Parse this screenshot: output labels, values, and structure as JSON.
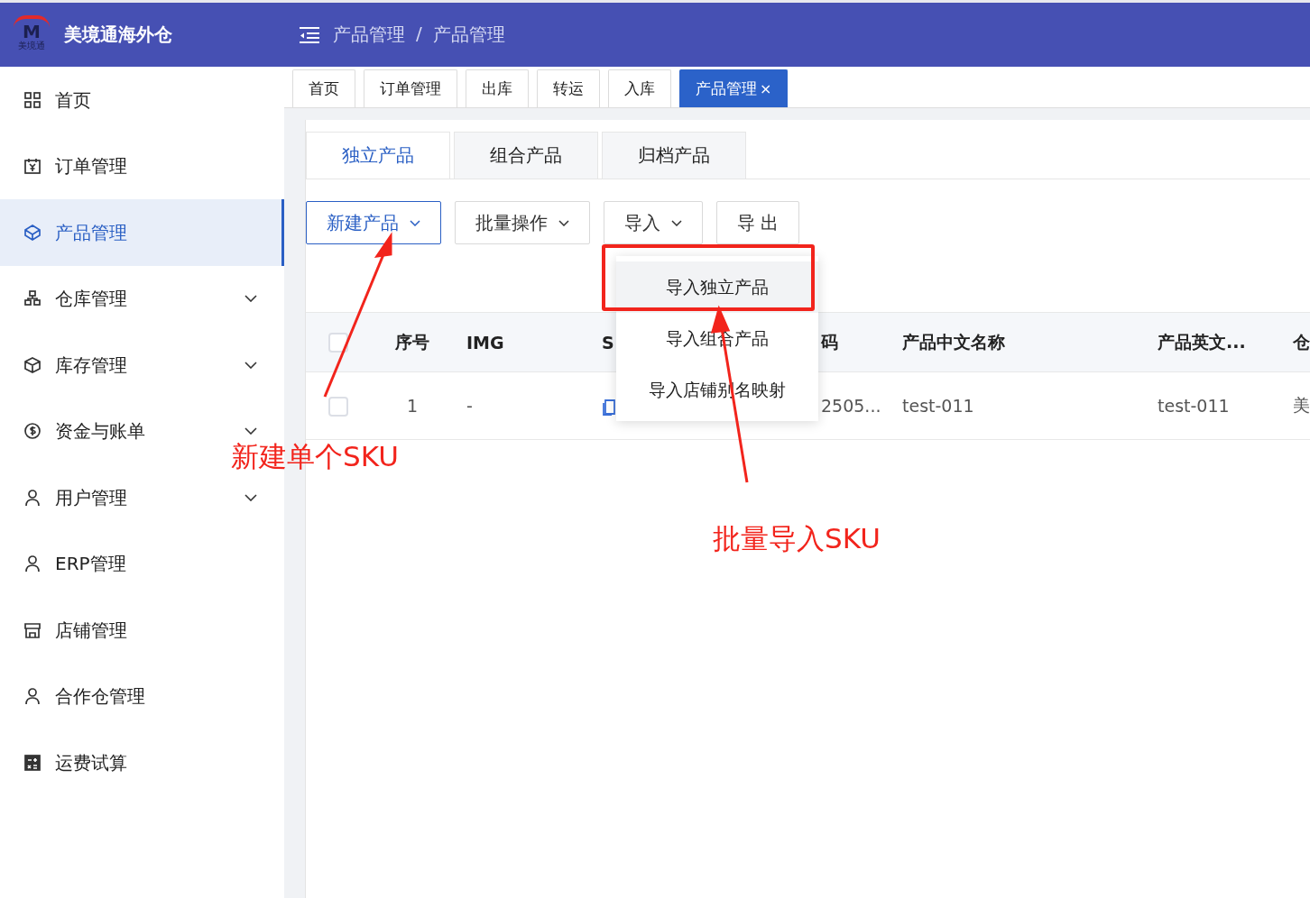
{
  "app": {
    "logo_mark": "M",
    "logo_caption": "美境通",
    "name": "美境通海外仓"
  },
  "breadcrumb": [
    "产品管理",
    "/",
    "产品管理"
  ],
  "sidebar": {
    "items": [
      {
        "label": "首页",
        "kind": "link",
        "selected": false
      },
      {
        "label": "订单管理",
        "kind": "link",
        "selected": false
      },
      {
        "label": "产品管理",
        "kind": "link",
        "selected": true
      },
      {
        "label": "仓库管理",
        "kind": "group",
        "selected": false
      },
      {
        "label": "库存管理",
        "kind": "group",
        "selected": false
      },
      {
        "label": "资金与账单",
        "kind": "group",
        "selected": false
      },
      {
        "label": "用户管理",
        "kind": "group",
        "selected": false
      },
      {
        "label": "ERP管理",
        "kind": "link",
        "selected": false
      },
      {
        "label": "店铺管理",
        "kind": "link",
        "selected": false
      },
      {
        "label": "合作仓管理",
        "kind": "link",
        "selected": false
      },
      {
        "label": "运费试算",
        "kind": "link",
        "selected": false
      }
    ]
  },
  "page_tabs": [
    {
      "label": "首页",
      "selected": false
    },
    {
      "label": "订单管理",
      "selected": false
    },
    {
      "label": "出库",
      "selected": false
    },
    {
      "label": "转运",
      "selected": false
    },
    {
      "label": "入库",
      "selected": false
    },
    {
      "label": "产品管理",
      "selected": true,
      "close": "×"
    }
  ],
  "sub_tabs": [
    {
      "label": "独立产品",
      "selected": true
    },
    {
      "label": "组合产品",
      "selected": false
    },
    {
      "label": "归档产品",
      "selected": false
    }
  ],
  "toolbar": [
    {
      "label": "新建产品",
      "dropdown": true,
      "selected": true
    },
    {
      "label": "批量操作",
      "dropdown": true,
      "selected": false
    },
    {
      "label": "导入",
      "dropdown": true,
      "selected": false
    },
    {
      "label": "导 出",
      "dropdown": false,
      "selected": false
    }
  ],
  "import_menu": [
    {
      "label": "导入独立产品",
      "selected": true
    },
    {
      "label": "导入组合产品",
      "selected": false
    },
    {
      "label": "导入店铺别名映射",
      "selected": false
    }
  ],
  "table": {
    "columns": [
      {
        "kind": "checkbox",
        "checked": false
      },
      {
        "label": "序号"
      },
      {
        "label": "IMG"
      },
      {
        "label": "S"
      },
      {
        "label": "码"
      },
      {
        "label": "产品中文名称"
      },
      {
        "label": "产品英文..."
      },
      {
        "label": "仓"
      }
    ],
    "rows": [
      {
        "cells": [
          {
            "kind": "checkbox",
            "checked": false
          },
          "1",
          "-",
          {
            "kind": "icon"
          },
          "2505...",
          "test-011",
          "test-011",
          "美"
        ]
      }
    ]
  },
  "annotations": [
    {
      "text": "新建单个SKU"
    },
    {
      "text": "批量导入SKU"
    }
  ]
}
